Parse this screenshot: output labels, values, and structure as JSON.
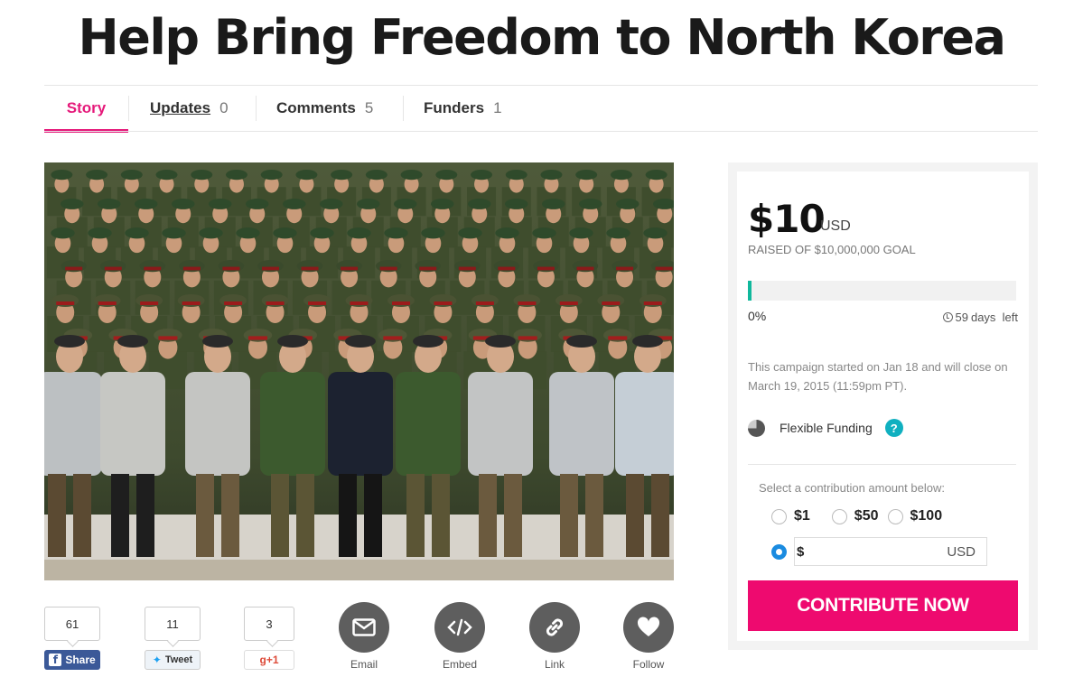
{
  "page": {
    "title": "Help Bring Freedom to North Korea"
  },
  "tabs": [
    {
      "label": "Story",
      "count": ""
    },
    {
      "label": "Updates",
      "count": "0"
    },
    {
      "label": "Comments",
      "count": "5"
    },
    {
      "label": "Funders",
      "count": "1"
    }
  ],
  "share": {
    "facebook": {
      "count": "61",
      "label": "Share",
      "icon": "facebook-icon"
    },
    "twitter": {
      "count": "11",
      "label": "Tweet",
      "icon": "twitter-bird-icon"
    },
    "googleplus": {
      "count": "3",
      "label": "g+1",
      "icon": "google-plus-icon"
    }
  },
  "actions": [
    {
      "label": "Email",
      "icon": "envelope-icon"
    },
    {
      "label": "Embed",
      "icon": "code-icon"
    },
    {
      "label": "Link",
      "icon": "chain-link-icon"
    },
    {
      "label": "Follow",
      "icon": "heart-icon"
    }
  ],
  "funding": {
    "amount": "$10",
    "currency": "USD",
    "goal_text": "RAISED OF $10,000,000 GOAL",
    "progress_percent": 0,
    "percent_label": "0%",
    "days_left_number": "59",
    "days_left_text": "days  left",
    "campaign_text": "This campaign started on Jan 18 and will close on March 19, 2015 (11:59pm PT).",
    "funding_type": "Flexible Funding",
    "help_label": "?",
    "select_text": "Select a contribution amount below:",
    "options": [
      "$1",
      "$50",
      "$100"
    ],
    "custom_prefix": "$",
    "custom_unit": "USD",
    "cta_label": "CONTRIBUTE NOW"
  },
  "colors": {
    "accent": "#e5197a",
    "cta": "#ee0a6f",
    "progress": "#10b89c",
    "radio_selected": "#1a8be0"
  }
}
